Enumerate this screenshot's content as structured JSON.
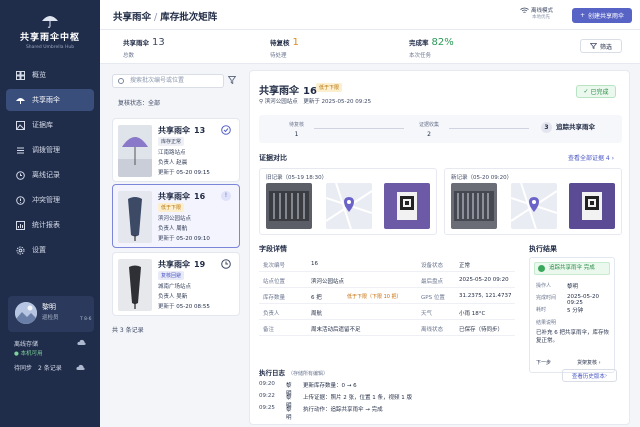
{
  "app": {
    "title": "共享雨伞中枢",
    "subtitle": "Shared Umbrella Hub"
  },
  "nav": [
    {
      "label": "概览",
      "icon": "grid-icon"
    },
    {
      "label": "共享雨伞",
      "icon": "umbrella-icon",
      "active": true
    },
    {
      "label": "证据库",
      "icon": "image-icon"
    },
    {
      "label": "调拨管理",
      "icon": "list-icon"
    },
    {
      "label": "离线记录",
      "icon": "clock-icon"
    },
    {
      "label": "冲突管理",
      "icon": "alert-icon"
    },
    {
      "label": "统计报表",
      "icon": "chart-icon"
    },
    {
      "label": "设置",
      "icon": "gear-icon"
    }
  ],
  "user": {
    "name": "黎明",
    "role": "巡检员",
    "shift": "T 8-6"
  },
  "sync": {
    "title": "离线存储",
    "status": "本机可用",
    "pending_label": "待同步",
    "pending_value": "2 条记录"
  },
  "breadcrumb": {
    "root": "共享雨伞",
    "sep": "/",
    "page": "库存批次矩阵"
  },
  "offline": {
    "label": "离线模式",
    "sub": "本地优先"
  },
  "create_button": "创建共享雨伞",
  "stats": [
    {
      "label": "共享雨伞",
      "value": "13",
      "sub": "总数",
      "color": "#3d4863"
    },
    {
      "label": "待复核",
      "value": "1",
      "sub": "待处理",
      "color": "#e08a1a"
    },
    {
      "label": "完成率",
      "value": "82%",
      "sub": "本次任务",
      "color": "#2b9a56"
    }
  ],
  "filter_button": "筛选",
  "search": {
    "placeholder": "搜索批次编号或位置"
  },
  "review_status": {
    "label": "复核状态：",
    "value": "全部"
  },
  "cards": [
    {
      "title": "共享雨伞",
      "num": "13",
      "tag": "库存正常",
      "place": "江南路站点",
      "owner_label": "负责人",
      "owner": "赵晨",
      "updated_label": "更新于",
      "updated": "05-20 09:15",
      "state": "check",
      "umbrella_color": "#8a78c8"
    },
    {
      "title": "共享雨伞",
      "num": "16",
      "tag": "低于下限",
      "place": "滨河公园站点",
      "owner_label": "负责人",
      "owner": "周航",
      "updated_label": "更新于",
      "updated": "05-20 09:10",
      "state": "alert",
      "umbrella_color": "#3c4a66"
    },
    {
      "title": "共享雨伞",
      "num": "19",
      "tag": "复核回避",
      "place": "城南广场站点",
      "owner_label": "负责人",
      "owner": "吴新",
      "updated_label": "更新于",
      "updated": "05-20 08:55",
      "state": "clock",
      "umbrella_color": "#2f2f36"
    }
  ],
  "count_text": "共 3 条记录",
  "detail": {
    "title": "共享雨伞",
    "num": "16",
    "tag": "低于下限",
    "place": "滨河公园站点",
    "updated": "更新于 2025-05-20 09:25",
    "done_badge": "已完成",
    "steps": [
      {
        "label": "待复核",
        "num": "1"
      },
      {
        "label": "证据收集",
        "num": "2"
      }
    ],
    "step_current": {
      "num": "3",
      "label": "追踪共享雨伞"
    },
    "evidence_title": "证据对比",
    "evidence_link": "查看全部证据 4",
    "evidence_old": "旧记录（05-19 18:30）",
    "evidence_new": "新记录（05-20 09:20）",
    "fields_title": "字段详情",
    "fields": [
      {
        "k1": "批次编号",
        "v1": "16",
        "k2": "设备状态",
        "v2": "正常"
      },
      {
        "k1": "站点位置",
        "v1": "滨河公园站点",
        "k2": "最后盘点",
        "v2": "2025-05-20 09:20"
      },
      {
        "k1": "库存数量",
        "v1": "6 把",
        "note": "低于下限（下限 10 把）",
        "k2": "GPS 位置",
        "v2": "31.2375, 121.4737"
      },
      {
        "k1": "负责人",
        "v1": "周航",
        "k2": "天气",
        "v2": "小雨 18°C"
      },
      {
        "k1": "备注",
        "v1": "周末活动后遗留不足",
        "k2": "离线状态",
        "v2": "已保存（待同步）"
      }
    ],
    "result_title": "执行结果",
    "result_banner": "追踪共享雨伞 完成",
    "result_rows": [
      {
        "k": "操作人",
        "v": "黎明"
      },
      {
        "k": "完成时间",
        "v": "2025-05-20 09:25"
      },
      {
        "k": "耗时",
        "v": "5 分钟"
      },
      {
        "k": "结果说明",
        "v": ""
      },
      {
        "k": "",
        "v": "已补充 6 把共享雨伞，库存恢复正常。"
      }
    ],
    "result_next": "下一步",
    "result_next_value": "货架复核",
    "log_title": "执行日志",
    "log_sub": "（存储所有编辑）",
    "history_button": "查看历史版本",
    "logs": [
      {
        "time": "09:20",
        "who": "黎明",
        "what": "更新库存数量：0 → 6"
      },
      {
        "time": "09:22",
        "who": "黎明",
        "what": "上传证据：照片 2 张，位置 1 条，视频 1 版"
      },
      {
        "time": "09:25",
        "who": "黎明",
        "what": "执行动作：追踪共享雨伞 → 完成"
      }
    ]
  }
}
